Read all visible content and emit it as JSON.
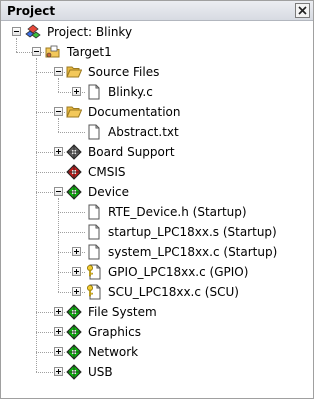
{
  "window": {
    "title": "Project",
    "close_icon": "close-icon"
  },
  "tree": [
    {
      "label": "Project: Blinky",
      "icon": "project-icon",
      "expander": "minus",
      "level": 0
    },
    {
      "label": "Target1",
      "icon": "target-folder-icon",
      "expander": "minus",
      "level": 1
    },
    {
      "label": "Source Files",
      "icon": "folder-open-icon",
      "expander": "minus",
      "level": 2
    },
    {
      "label": "Blinky.c",
      "icon": "file-icon",
      "expander": "plus",
      "level": 3
    },
    {
      "label": "Documentation",
      "icon": "folder-open-icon",
      "expander": "minus",
      "level": 2
    },
    {
      "label": "Abstract.txt",
      "icon": "file-icon",
      "expander": "none",
      "level": 3
    },
    {
      "label": "Board Support",
      "icon": "component-gray-icon",
      "expander": "plus",
      "level": 2
    },
    {
      "label": "CMSIS",
      "icon": "component-red-icon",
      "expander": "none",
      "level": 2
    },
    {
      "label": "Device",
      "icon": "component-green-icon",
      "expander": "minus",
      "level": 2
    },
    {
      "label": "RTE_Device.h (Startup)",
      "icon": "file-icon",
      "expander": "none",
      "level": 3
    },
    {
      "label": "startup_LPC18xx.s (Startup)",
      "icon": "file-icon",
      "expander": "none",
      "level": 3
    },
    {
      "label": "system_LPC18xx.c (Startup)",
      "icon": "file-icon",
      "expander": "plus",
      "level": 3
    },
    {
      "label": "GPIO_LPC18xx.c (GPIO)",
      "icon": "file-key-icon",
      "expander": "plus",
      "level": 3
    },
    {
      "label": "SCU_LPC18xx.c (SCU)",
      "icon": "file-key-icon",
      "expander": "plus",
      "level": 3
    },
    {
      "label": "File System",
      "icon": "component-green-icon",
      "expander": "plus",
      "level": 2
    },
    {
      "label": "Graphics",
      "icon": "component-green-icon",
      "expander": "plus",
      "level": 2
    },
    {
      "label": "Network",
      "icon": "component-green-icon",
      "expander": "plus",
      "level": 2
    },
    {
      "label": "USB",
      "icon": "component-green-icon",
      "expander": "plus",
      "level": 2
    }
  ],
  "colors": {
    "component_green": "#11b511",
    "component_red": "#c02020",
    "component_gray": "#606060",
    "folder_yellow": "#f3c85a"
  }
}
